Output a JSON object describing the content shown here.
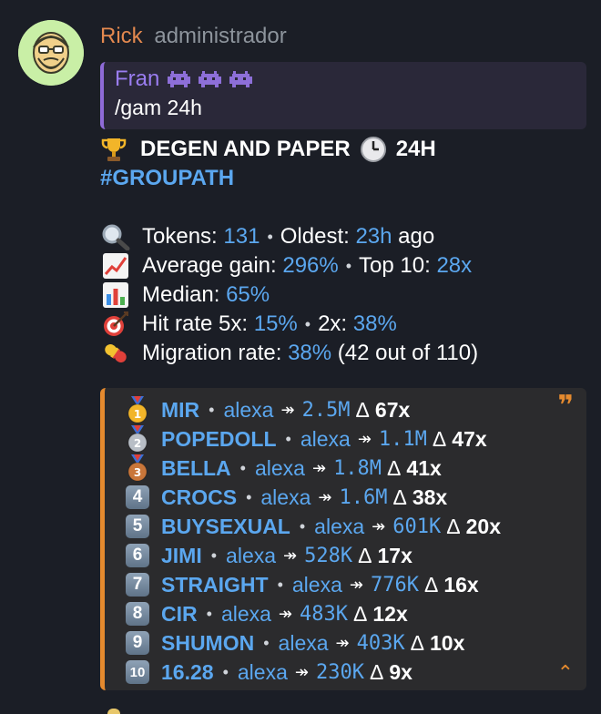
{
  "sender": {
    "name": "Rick",
    "role": "administrador"
  },
  "reply": {
    "author": "Fran",
    "author_icons": [
      "alien-monster-icon",
      "alien-monster-icon",
      "alien-monster-icon"
    ],
    "text": "/gam 24h"
  },
  "header": {
    "title_prefix": "DEGEN AND PAPER",
    "title_suffix": "24H",
    "hashtag": "#GROUPATH"
  },
  "stats": {
    "tokens_label": "Tokens:",
    "tokens_value": "131",
    "oldest_label": "Oldest:",
    "oldest_value": "23h",
    "oldest_suffix": "ago",
    "avg_label": "Average gain:",
    "avg_value": "296%",
    "top10_label": "Top 10:",
    "top10_value": "28x",
    "median_label": "Median:",
    "median_value": "65%",
    "hit_label": "Hit rate 5x:",
    "hit5_value": "15%",
    "hit2_label": "2x:",
    "hit2_value": "38%",
    "migration_label": "Migration rate:",
    "migration_value": "38%",
    "migration_detail": "(42 out of 110)"
  },
  "separators": {
    "dot": "•",
    "arrow": "↠",
    "delta": "Δ",
    "quote_mark": "❞",
    "collapse": "⌃"
  },
  "ranking": [
    {
      "badge": "gold-medal-icon",
      "badge_text": "1",
      "token": "MIR",
      "user": "alexa",
      "mcap": "2.5M",
      "mult": "67x"
    },
    {
      "badge": "silver-medal-icon",
      "badge_text": "2",
      "token": "POPEDOLL",
      "user": "alexa",
      "mcap": "1.1M",
      "mult": "47x"
    },
    {
      "badge": "bronze-medal-icon",
      "badge_text": "3",
      "token": "BELLA",
      "user": "alexa",
      "mcap": "1.8M",
      "mult": "41x"
    },
    {
      "badge": "keycap-4-icon",
      "badge_text": "4",
      "token": "CROCS",
      "user": "alexa",
      "mcap": "1.6M",
      "mult": "38x"
    },
    {
      "badge": "keycap-5-icon",
      "badge_text": "5",
      "token": "BUYSEXUAL",
      "user": "alexa",
      "mcap": "601K",
      "mult": "20x"
    },
    {
      "badge": "keycap-6-icon",
      "badge_text": "6",
      "token": "JIMI",
      "user": "alexa",
      "mcap": "528K",
      "mult": "17x"
    },
    {
      "badge": "keycap-7-icon",
      "badge_text": "7",
      "token": "STRAIGHT",
      "user": "alexa",
      "mcap": "776K",
      "mult": "16x"
    },
    {
      "badge": "keycap-8-icon",
      "badge_text": "8",
      "token": "CIR",
      "user": "alexa",
      "mcap": "483K",
      "mult": "12x"
    },
    {
      "badge": "keycap-9-icon",
      "badge_text": "9",
      "token": "SHUMON",
      "user": "alexa",
      "mcap": "403K",
      "mult": "10x"
    },
    {
      "badge": "keycap-10-icon",
      "badge_text": "10",
      "token": "16.28",
      "user": "alexa",
      "mcap": "230K",
      "mult": "9x"
    }
  ]
}
